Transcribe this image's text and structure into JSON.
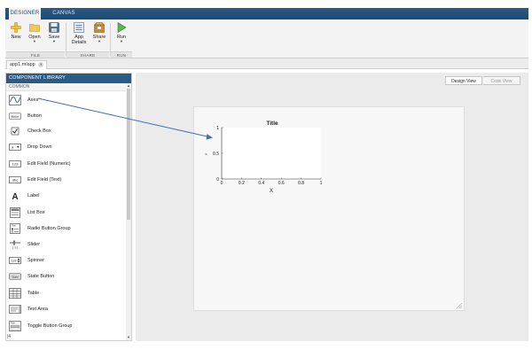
{
  "tabs": [
    {
      "label": "DESIGNER",
      "active": true
    },
    {
      "label": "CANVAS",
      "active": false
    }
  ],
  "toolstrip": {
    "buttons": [
      {
        "label": "New",
        "icon": "plus-icon"
      },
      {
        "label": "Open",
        "icon": "folder-icon"
      },
      {
        "label": "Save",
        "icon": "floppy-disk-icon"
      },
      {
        "label": "App Details",
        "icon": "details-icon"
      },
      {
        "label": "Share",
        "icon": "package-icon"
      },
      {
        "label": "Run",
        "icon": "play-icon"
      }
    ],
    "groups": [
      "FILE",
      "SHARE",
      "RUN"
    ]
  },
  "file_tab": {
    "label": "app1.mlapp",
    "close_icon": "close-icon"
  },
  "library": {
    "title": "COMPONENT LIBRARY",
    "section": "COMMON",
    "components": [
      {
        "label": "Axes",
        "icon": "axes-icon"
      },
      {
        "label": "Button",
        "icon": "button-icon",
        "icon_text": "Button"
      },
      {
        "label": "Check Box",
        "icon": "checkbox-icon"
      },
      {
        "label": "Drop Down",
        "icon": "dropdown-icon",
        "icon_text": "a"
      },
      {
        "label": "Edit Field (Numeric)",
        "icon": "numeric-field-icon",
        "icon_text": "123"
      },
      {
        "label": "Edit Field (Text)",
        "icon": "text-field-icon",
        "icon_text": "abc"
      },
      {
        "label": "Label",
        "icon": "label-icon",
        "icon_text": "A"
      },
      {
        "label": "List Box",
        "icon": "listbox-icon"
      },
      {
        "label": "Radio Button Group",
        "icon": "radio-group-icon",
        "icon_text": "Title"
      },
      {
        "label": "Slider",
        "icon": "slider-icon",
        "icon_text": "1 3 5"
      },
      {
        "label": "Spinner",
        "icon": "spinner-icon",
        "icon_text": "123"
      },
      {
        "label": "State Button",
        "icon": "state-button-icon",
        "icon_text": "State"
      },
      {
        "label": "Table",
        "icon": "table-icon"
      },
      {
        "label": "Text Area",
        "icon": "text-area-icon"
      },
      {
        "label": "Toggle Button Group",
        "icon": "toggle-group-icon",
        "icon_text": "Title"
      }
    ],
    "footer": "|4"
  },
  "view_toggle": {
    "design_view": "Design View",
    "code_view": "Code View",
    "active": "Design View"
  },
  "axes_preview": {
    "title": "Title",
    "xlabel": "X",
    "ylabel": "Y",
    "x_ticks": [
      "0",
      "0.2",
      "0.4",
      "0.6",
      "0.8",
      "1"
    ],
    "y_ticks": [
      "0",
      "0.5",
      "1"
    ]
  },
  "colors": {
    "accent": "#2a5a86",
    "arrow": "#3f6fb4",
    "toolstrip_bg": "#f3f3f3",
    "canvas_bg": "#ebebeb"
  }
}
